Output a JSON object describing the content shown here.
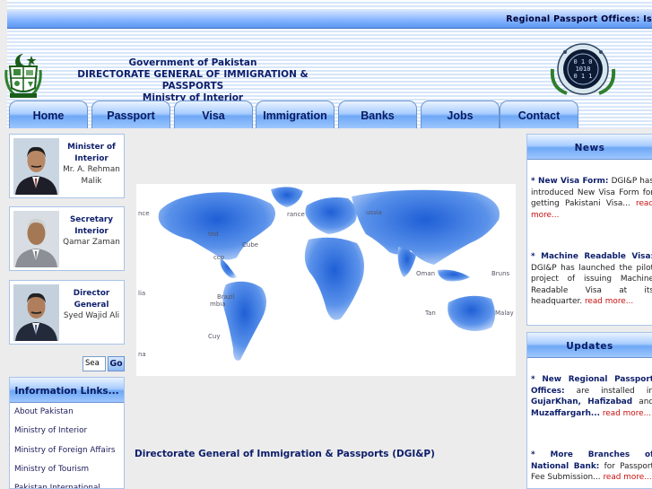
{
  "header": {
    "regional_offices_text": "Regional Passport Offices: Is",
    "gov_line": "Government of Pakistan",
    "directorate_line": "DIRECTORATE GENERAL OF IMMIGRATION & PASSPORTS",
    "ministry_line": "Ministry of Interior"
  },
  "nav": {
    "tabs": [
      {
        "label": "Home"
      },
      {
        "label": "Passport"
      },
      {
        "label": "Visa"
      },
      {
        "label": "Immigration"
      },
      {
        "label": "Banks"
      },
      {
        "label": "Jobs"
      },
      {
        "label": "Contact"
      }
    ]
  },
  "officials": [
    {
      "role": "Minister of Interior",
      "name": "Mr. A. Rehman Malik"
    },
    {
      "role": "Secretary Interior",
      "name": "Qamar Zaman"
    },
    {
      "role": "Director General",
      "name": "Syed Wajid Ali"
    }
  ],
  "search": {
    "value": "Sea",
    "button_label": "Go"
  },
  "info_links": {
    "title": "Information Links...",
    "items": [
      {
        "label": "About Pakistan"
      },
      {
        "label": "Ministry of Interior"
      },
      {
        "label": "Ministry of Foreign Affairs"
      },
      {
        "label": "Ministry of Tourism"
      },
      {
        "label": "Pakistan International"
      }
    ]
  },
  "map_labels": [
    "nce",
    "rance",
    "ussia",
    "ted",
    "Cube",
    "cco",
    "Oman",
    "Bruns",
    "lia",
    "Brazil",
    "Tan",
    "Malay",
    "mbia",
    "Cuy",
    "na"
  ],
  "main": {
    "caption": "Directorate General of Immigration & Passports (DGI&P)"
  },
  "news": {
    "title": "News",
    "items": [
      {
        "title": "* New Visa Form:",
        "body": "DGI&P has introduced New Visa Form for getting Pakistani Visa...",
        "more": "read more..."
      },
      {
        "title": "* Machine Readable Visa:",
        "body": "DGI&P has launched the pilot project of issuing Machine Readable Visa at its headquarter.",
        "more": "read more..."
      }
    ]
  },
  "updates": {
    "title": "Updates",
    "items": [
      {
        "title": "* New Regional Passport Offices:",
        "body": "are installed in",
        "places": "GujarKhan, Hafizabad",
        "and": "and",
        "last": "Muzaffargarh...",
        "more": "read more..."
      },
      {
        "title": "* More Branches of National Bank:",
        "body": "for Passport Fee Submission...",
        "more": "read more..."
      }
    ]
  }
}
